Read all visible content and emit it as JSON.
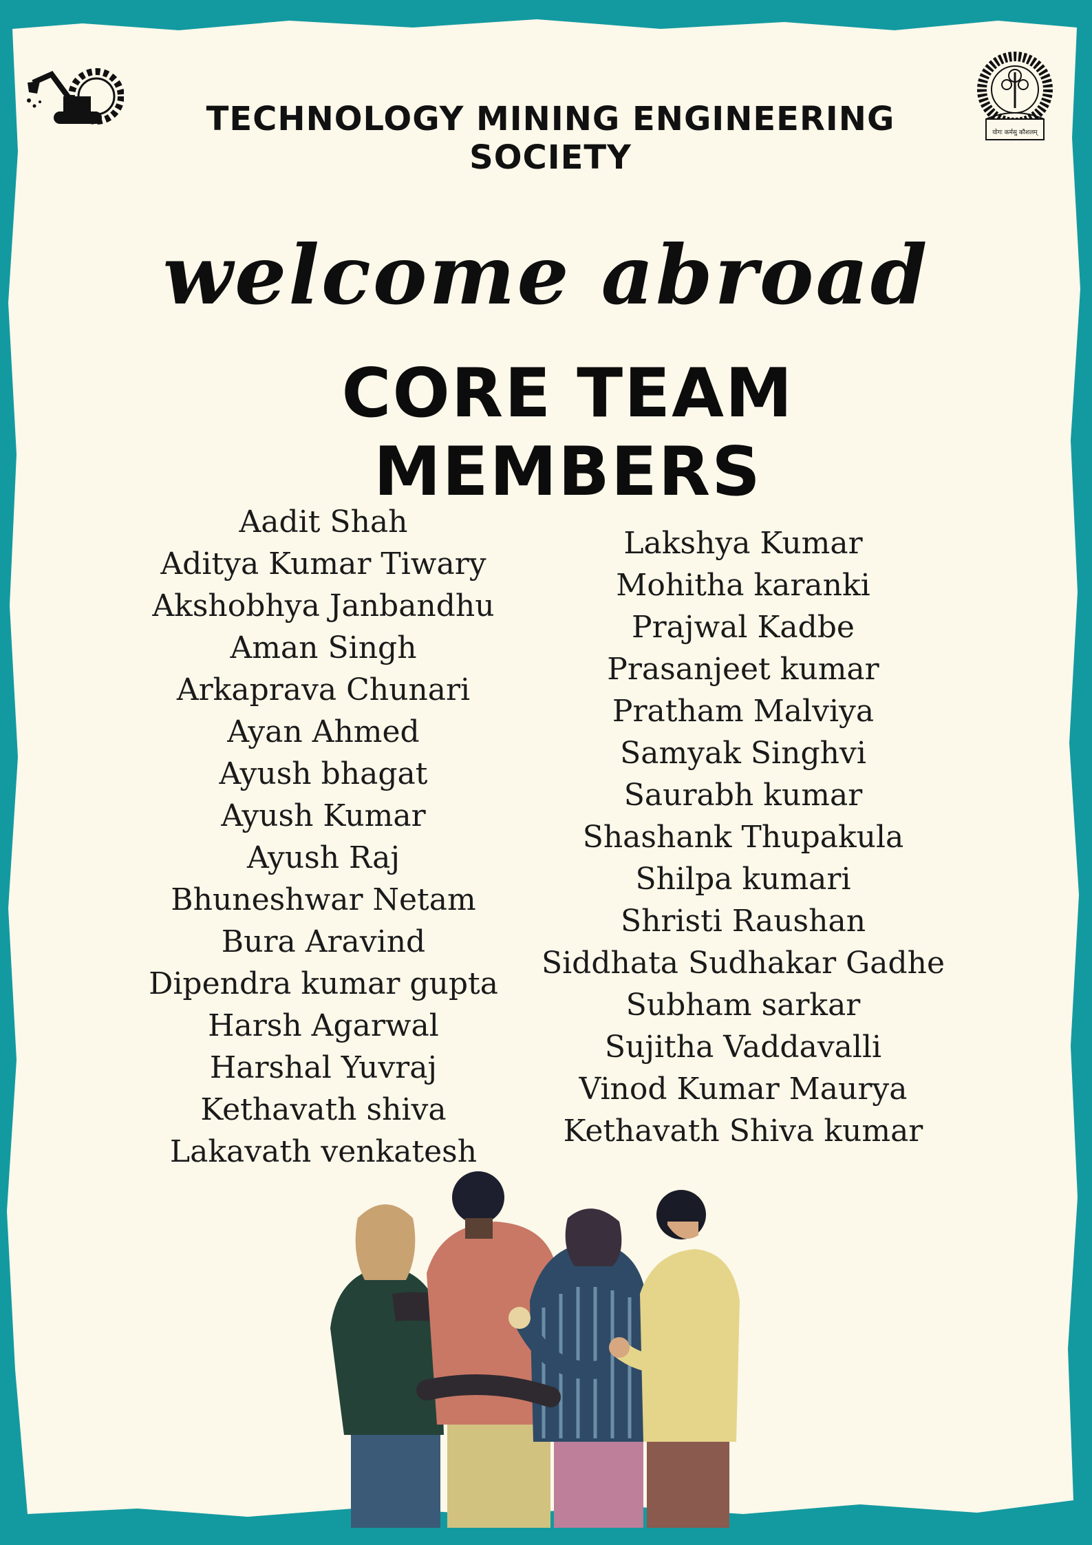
{
  "header": {
    "title": "TECHNOLOGY MINING ENGINEERING SOCIETY",
    "left_logo_icon": "mining-excavator-gear-logo",
    "right_logo_icon": "institute-emblem-logo",
    "right_logo_caption": "योगः कर्मसु कौशलम्"
  },
  "welcome_text": "welcome abroad",
  "section_title": "CORE TEAM MEMBERS",
  "members_left": [
    "Aadit Shah",
    "Aditya Kumar Tiwary",
    "Akshobhya Janbandhu",
    "Aman Singh",
    "Arkaprava Chunari",
    "Ayan Ahmed",
    "Ayush bhagat",
    "Ayush Kumar",
    "Ayush Raj",
    "Bhuneshwar Netam",
    "Bura Aravind",
    "Dipendra kumar gupta",
    "Harsh Agarwal",
    "Harshal Yuvraj",
    "Kethavath shiva",
    "Lakavath venkatesh"
  ],
  "members_right": [
    "Lakshya Kumar",
    "Mohitha karanki",
    "Prajwal Kadbe",
    "Prasanjeet kumar",
    "Pratham Malviya",
    "Samyak Singhvi",
    "Saurabh kumar",
    "Shashank Thupakula",
    "Shilpa kumari",
    "Shristi Raushan",
    "Siddhata Sudhakar Gadhe",
    "Subham sarkar",
    "Sujitha Vaddavalli",
    "Vinod Kumar Maurya",
    "Kethavath Shiva kumar"
  ],
  "illustration_icon": "group-hug-illustration",
  "colors": {
    "border": "#139aa0",
    "paper": "#fcf8ea",
    "text": "#111111"
  }
}
